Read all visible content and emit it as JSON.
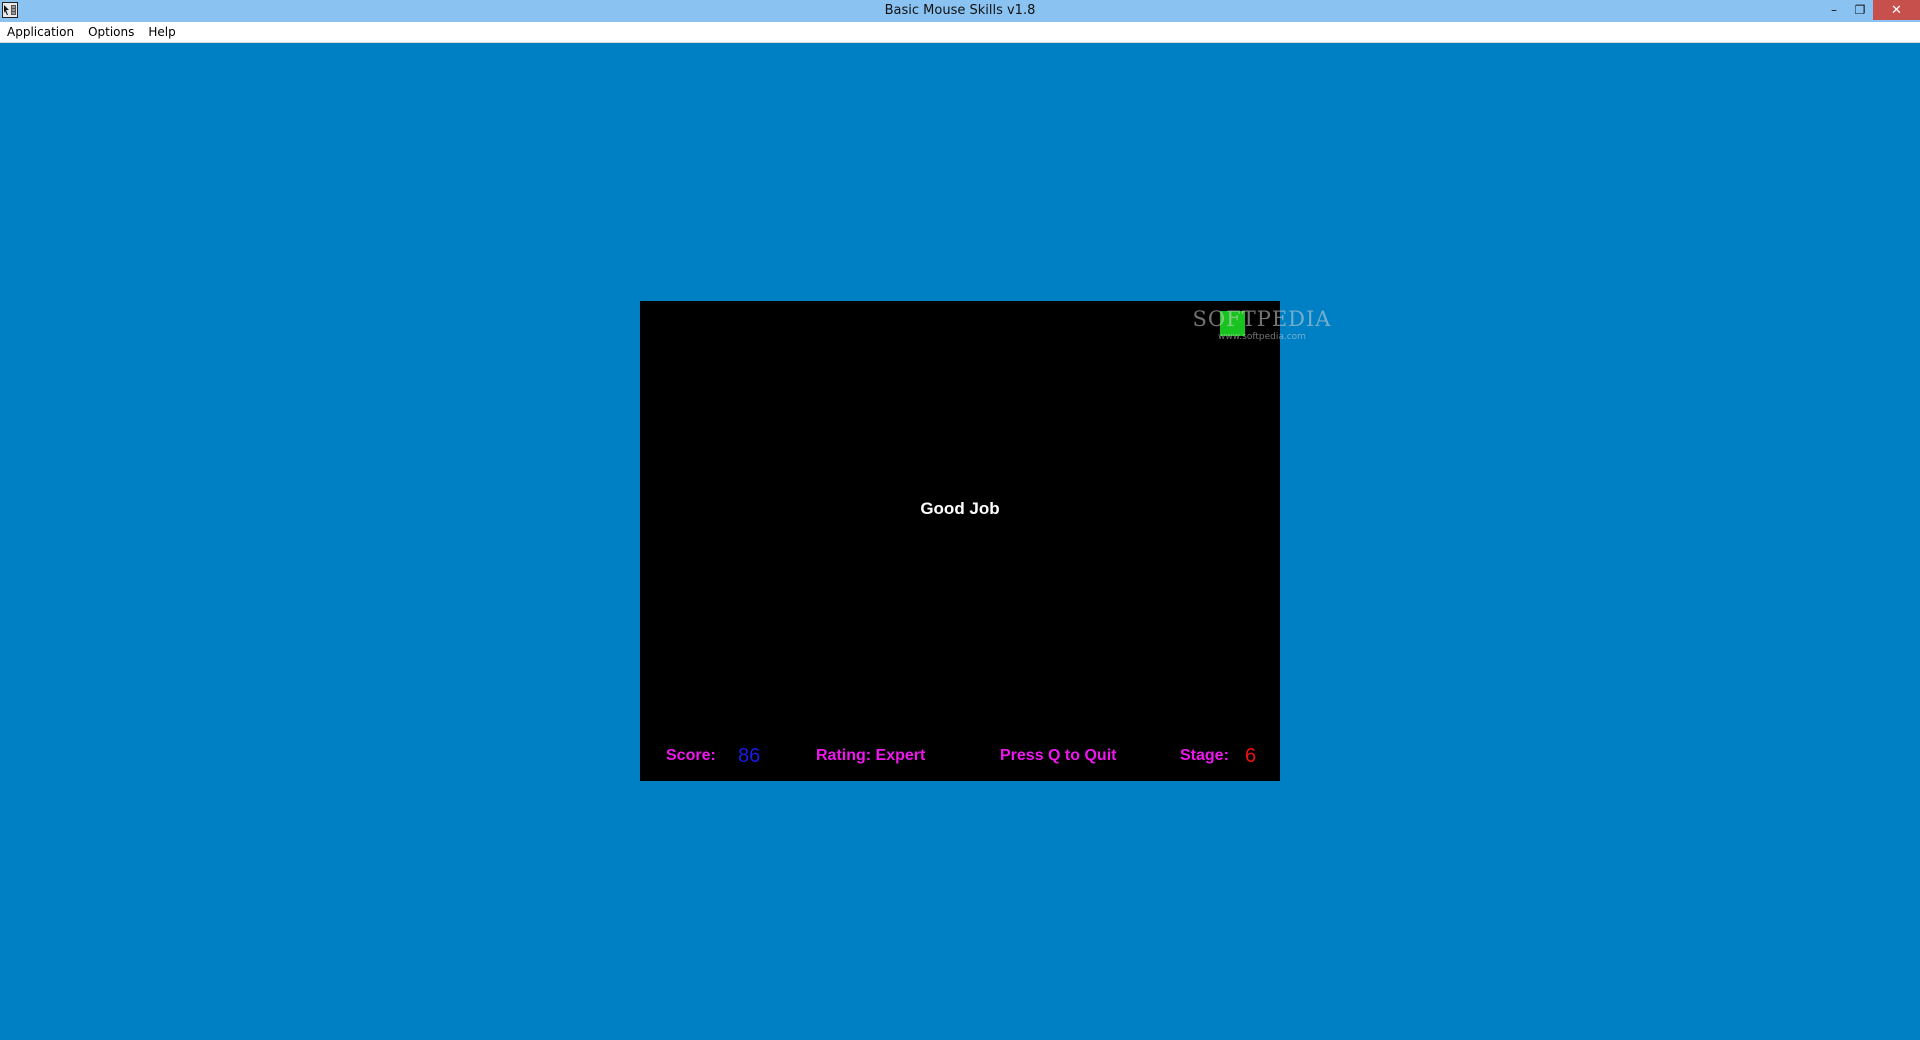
{
  "window": {
    "title": "Basic Mouse Skills v1.8",
    "minimize_glyph": "–",
    "restore_glyph": "❐",
    "close_glyph": "✕"
  },
  "menu": {
    "items": [
      "Application",
      "Options",
      "Help"
    ]
  },
  "game": {
    "message": "Good Job",
    "score_label": "Score:",
    "score_value": "86",
    "rating_text": "Rating: Expert",
    "quit_hint": "Press Q to Quit",
    "stage_label": "Stage:",
    "stage_value": "6",
    "watermark_logo": "SOFTPEDIA",
    "watermark_url": "www.softpedia.com"
  },
  "colors": {
    "desktop_background": "#0080c4",
    "titlebar": "#8ac3f2",
    "game_background": "#000000",
    "target": "#19c31f",
    "status_label": "#ee18ee",
    "score_value": "#1a1ae6",
    "stage_value": "#f01010",
    "message": "#ffffff"
  },
  "icons": {
    "app": "app-icon",
    "minimize": "minimize-icon",
    "restore": "restore-icon",
    "close": "close-icon"
  }
}
